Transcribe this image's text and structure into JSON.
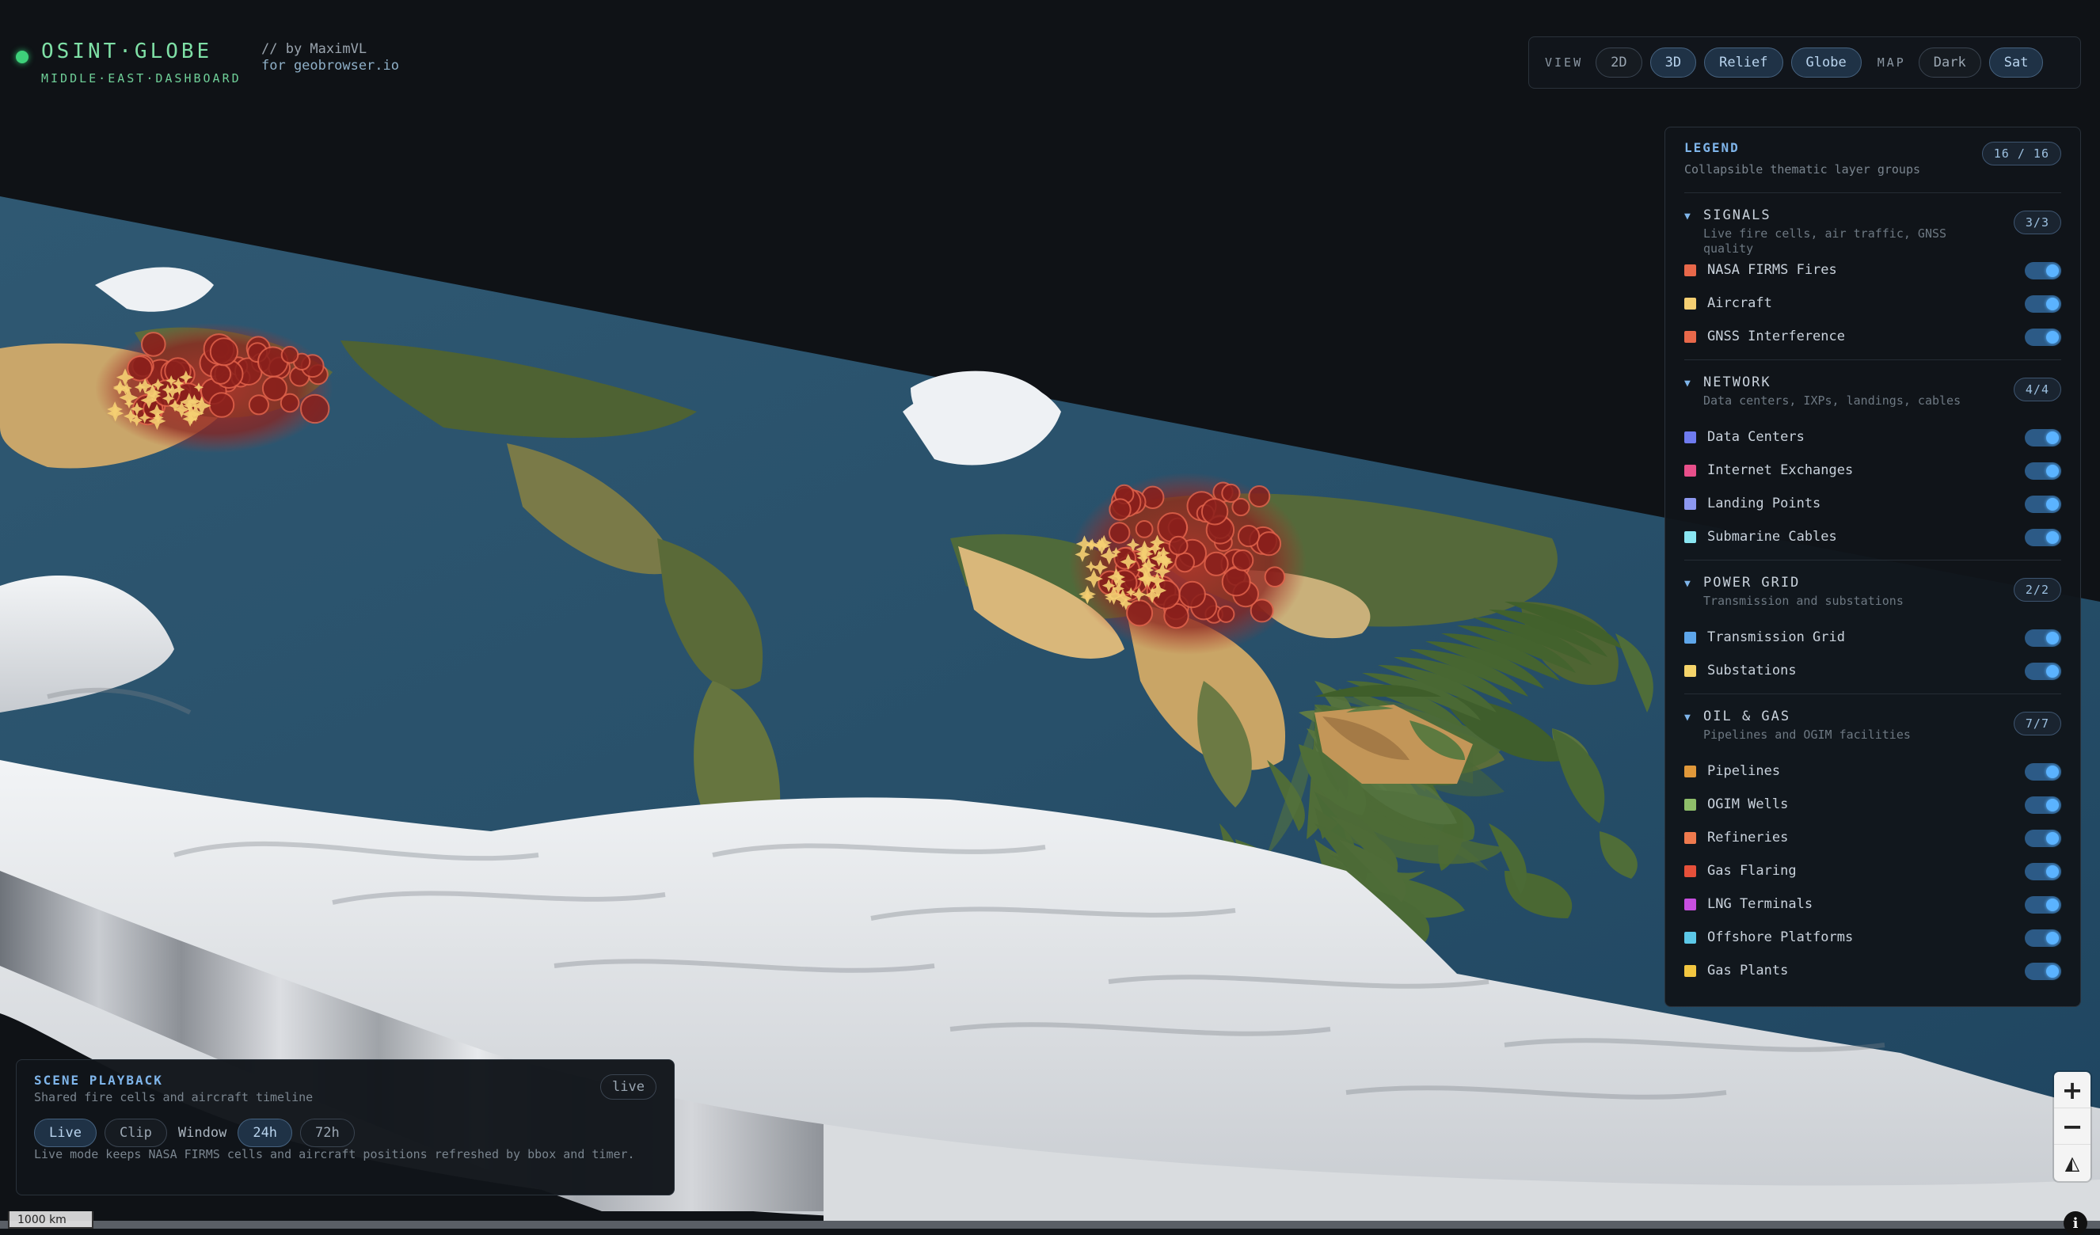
{
  "header": {
    "title": "OSINT·GLOBE",
    "subtitle": "MIDDLE·EAST·DASHBOARD",
    "credit_line1": "// by MaximVL",
    "credit_line2": "for geobrowser.io"
  },
  "viewbar": {
    "view_label": "VIEW",
    "view_options": [
      "2D",
      "3D",
      "Relief",
      "Globe"
    ],
    "map_label": "MAP",
    "map_options": [
      "Dark",
      "Sat"
    ],
    "active": [
      "3D",
      "Relief",
      "Globe",
      "Sat"
    ]
  },
  "legend": {
    "title": "LEGEND",
    "subtitle": "Collapsible thematic layer groups",
    "count": "16 / 16",
    "groups": [
      {
        "title": "SIGNALS",
        "desc": "Live fire cells, air traffic, GNSS quality",
        "count": "3/3",
        "layers": [
          {
            "label": "NASA FIRMS Fires",
            "color": "#e8684a",
            "on": true
          },
          {
            "label": "Aircraft",
            "color": "#f5cf72",
            "on": true
          },
          {
            "label": "GNSS Interference",
            "color": "#e8684a",
            "on": true
          }
        ]
      },
      {
        "title": "NETWORK",
        "desc": "Data centers, IXPs, landings, cables",
        "count": "4/4",
        "layers": [
          {
            "label": "Data Centers",
            "color": "#6f7bef",
            "on": true
          },
          {
            "label": "Internet Exchanges",
            "color": "#e84f8a",
            "on": true
          },
          {
            "label": "Landing Points",
            "color": "#8d98f0",
            "on": true
          },
          {
            "label": "Submarine Cables",
            "color": "#8ae6f2",
            "on": true
          }
        ]
      },
      {
        "title": "POWER GRID",
        "desc": "Transmission and substations",
        "count": "2/2",
        "layers": [
          {
            "label": "Transmission Grid",
            "color": "#5ea6ea",
            "on": true
          },
          {
            "label": "Substations",
            "color": "#f5d46a",
            "on": true
          }
        ]
      },
      {
        "title": "OIL & GAS",
        "desc": "Pipelines and OGIM facilities",
        "count": "7/7",
        "layers": [
          {
            "label": "Pipelines",
            "color": "#e0983a",
            "on": true
          },
          {
            "label": "OGIM Wells",
            "color": "#8fbf6a",
            "on": true
          },
          {
            "label": "Refineries",
            "color": "#ef7a4e",
            "on": true
          },
          {
            "label": "Gas Flaring",
            "color": "#e6503a",
            "on": true
          },
          {
            "label": "LNG Terminals",
            "color": "#c74fe0",
            "on": true
          },
          {
            "label": "Offshore Platforms",
            "color": "#5cc8e8",
            "on": true
          },
          {
            "label": "Gas Plants",
            "color": "#f2c640",
            "on": true
          }
        ]
      }
    ]
  },
  "playback": {
    "title": "SCENE PLAYBACK",
    "subtitle": "Shared fire cells and aircraft timeline",
    "mode_badge": "live",
    "modes": [
      "Live",
      "Clip"
    ],
    "window_label": "Window",
    "windows": [
      "24h",
      "72h"
    ],
    "active": [
      "Live",
      "24h"
    ],
    "note": "Live mode keeps NASA FIRMS cells and aircraft positions refreshed by bbox and timer."
  },
  "map": {
    "scale_label": "1000 km",
    "zoom_in": "+",
    "zoom_out": "−",
    "compass": "◭",
    "attribution": "i"
  }
}
